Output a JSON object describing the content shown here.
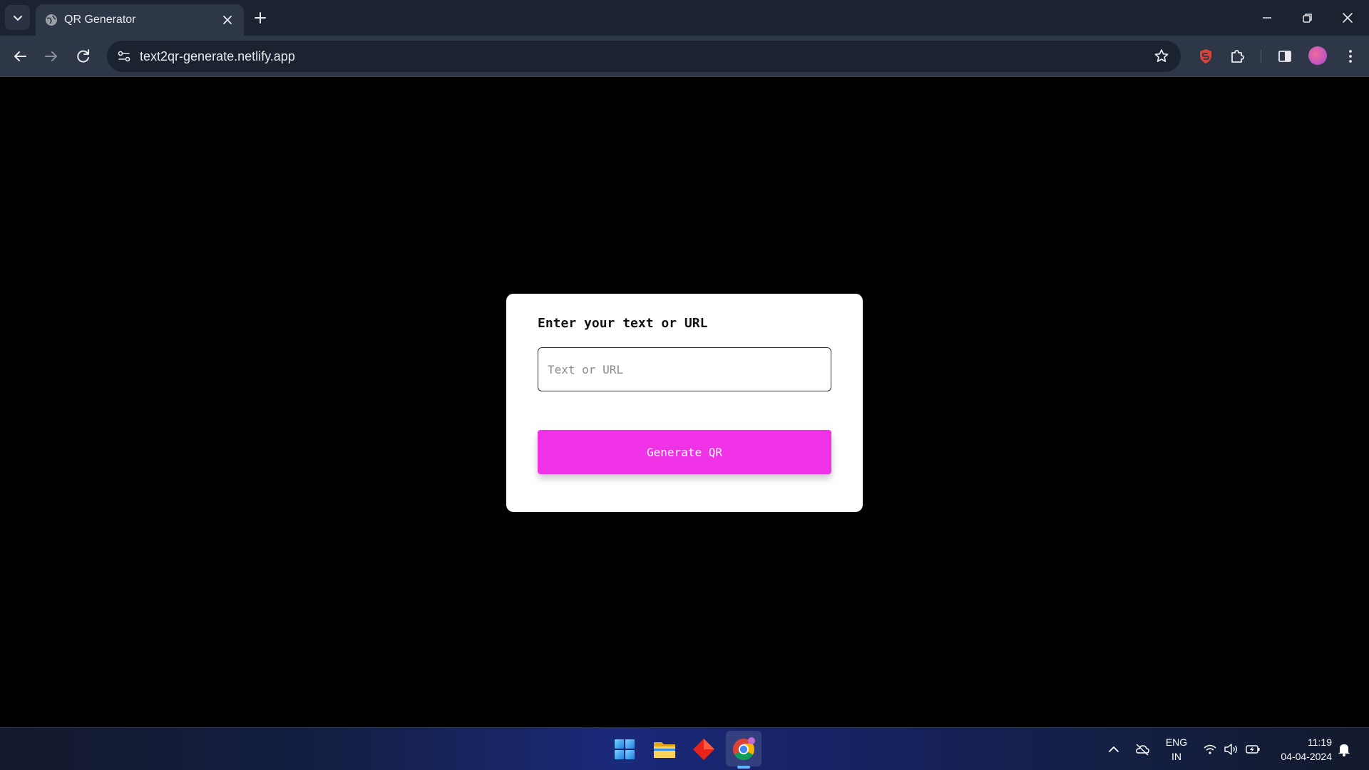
{
  "browser": {
    "tab": {
      "title": "QR Generator",
      "favicon": "globe-icon"
    },
    "url": "text2qr-generate.netlify.app",
    "colors": {
      "chrome_dark": "#1b2230",
      "chrome_toolbar": "#2e3747"
    }
  },
  "page": {
    "background": "#000000",
    "card": {
      "label": "Enter your text or URL",
      "input": {
        "value": "",
        "placeholder": "Text or URL"
      },
      "button_label": "Generate QR",
      "button_color": "#f032e6"
    }
  },
  "taskbar": {
    "apps": [
      "windows-start-icon",
      "file-explorer-icon",
      "diamond-app-icon",
      "chrome-icon"
    ],
    "language": {
      "line1": "ENG",
      "line2": "IN"
    },
    "time": "11:19",
    "date": "04-04-2024"
  }
}
